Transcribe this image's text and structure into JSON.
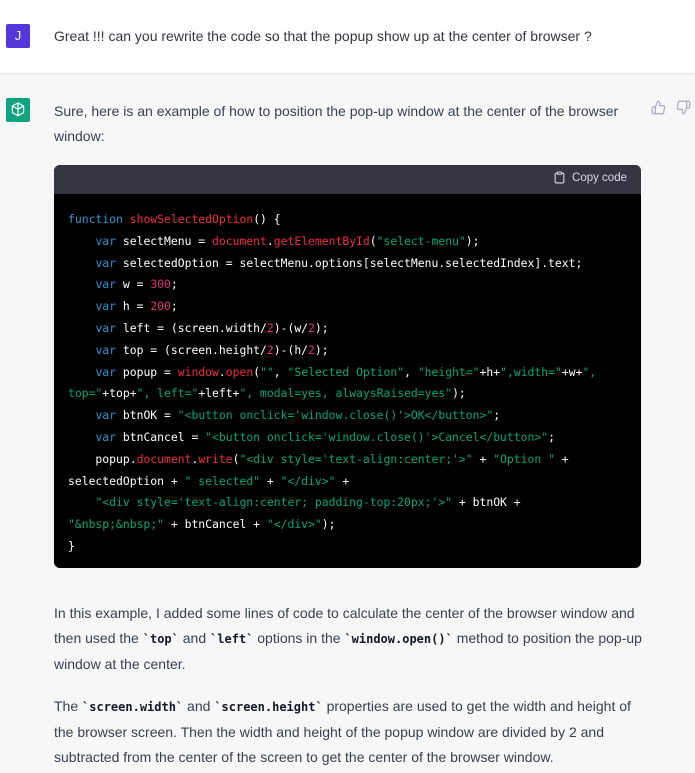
{
  "user": {
    "avatar_letter": "J",
    "message": "Great !!! can you rewrite the code so that the popup show up at the center of browser ?"
  },
  "assistant": {
    "intro": "Sure, here is an example of how to position the pop-up window at the center of the browser window:",
    "copy_label": "Copy code",
    "code_lines": [
      [
        [
          "kw",
          "function "
        ],
        [
          "fn",
          "showSelectedOption"
        ],
        [
          "plain",
          "() {"
        ]
      ],
      [
        [
          "plain",
          "    "
        ],
        [
          "kw",
          "var"
        ],
        [
          "plain",
          " selectMenu = "
        ],
        [
          "fn",
          "document"
        ],
        [
          "plain",
          "."
        ],
        [
          "fn",
          "getElementById"
        ],
        [
          "plain",
          "("
        ],
        [
          "str",
          "\"select-menu\""
        ],
        [
          "plain",
          ");"
        ]
      ],
      [
        [
          "plain",
          "    "
        ],
        [
          "kw",
          "var"
        ],
        [
          "plain",
          " selectedOption = selectMenu.options[selectMenu.selectedIndex].text;"
        ]
      ],
      [
        [
          "plain",
          "    "
        ],
        [
          "kw",
          "var"
        ],
        [
          "plain",
          " w = "
        ],
        [
          "num",
          "300"
        ],
        [
          "plain",
          ";"
        ]
      ],
      [
        [
          "plain",
          "    "
        ],
        [
          "kw",
          "var"
        ],
        [
          "plain",
          " h = "
        ],
        [
          "num",
          "200"
        ],
        [
          "plain",
          ";"
        ]
      ],
      [
        [
          "plain",
          "    "
        ],
        [
          "kw",
          "var"
        ],
        [
          "plain",
          " left = (screen.width/"
        ],
        [
          "num",
          "2"
        ],
        [
          "plain",
          ")-(w/"
        ],
        [
          "num",
          "2"
        ],
        [
          "plain",
          ");"
        ]
      ],
      [
        [
          "plain",
          "    "
        ],
        [
          "kw",
          "var"
        ],
        [
          "plain",
          " top = (screen.height/"
        ],
        [
          "num",
          "2"
        ],
        [
          "plain",
          ")-(h/"
        ],
        [
          "num",
          "2"
        ],
        [
          "plain",
          ");"
        ]
      ],
      [
        [
          "plain",
          "    "
        ],
        [
          "kw",
          "var"
        ],
        [
          "plain",
          " popup = "
        ],
        [
          "fn",
          "window"
        ],
        [
          "plain",
          "."
        ],
        [
          "fn",
          "open"
        ],
        [
          "plain",
          "("
        ],
        [
          "str",
          "\"\""
        ],
        [
          "plain",
          ", "
        ],
        [
          "str",
          "\"Selected Option\""
        ],
        [
          "plain",
          ", "
        ],
        [
          "str",
          "\"height=\""
        ],
        [
          "plain",
          "+h+"
        ],
        [
          "str",
          "\",width=\""
        ],
        [
          "plain",
          "+w+"
        ],
        [
          "str",
          "\","
        ]
      ],
      [
        [
          "str",
          "top=\""
        ],
        [
          "plain",
          "+top+"
        ],
        [
          "str",
          "\", left=\""
        ],
        [
          "plain",
          "+left+"
        ],
        [
          "str",
          "\", modal=yes, alwaysRaised=yes\""
        ],
        [
          "plain",
          ");"
        ]
      ],
      [
        [
          "plain",
          "    "
        ],
        [
          "kw",
          "var"
        ],
        [
          "plain",
          " btnOK = "
        ],
        [
          "str",
          "\"<button onclick='window.close()'>OK</button>\""
        ],
        [
          "plain",
          ";"
        ]
      ],
      [
        [
          "plain",
          "    "
        ],
        [
          "kw",
          "var"
        ],
        [
          "plain",
          " btnCancel = "
        ],
        [
          "str",
          "\"<button onclick='window.close()'>Cancel</button>\""
        ],
        [
          "plain",
          ";"
        ]
      ],
      [
        [
          "plain",
          "    popup."
        ],
        [
          "fn",
          "document"
        ],
        [
          "plain",
          "."
        ],
        [
          "fn",
          "write"
        ],
        [
          "plain",
          "("
        ],
        [
          "str",
          "\"<div style='text-align:center;'>\""
        ],
        [
          "plain",
          " + "
        ],
        [
          "str",
          "\"Option \""
        ],
        [
          "plain",
          " +"
        ]
      ],
      [
        [
          "plain",
          "selectedOption + "
        ],
        [
          "str",
          "\" selected\""
        ],
        [
          "plain",
          " + "
        ],
        [
          "str",
          "\"</div>\""
        ],
        [
          "plain",
          " +"
        ]
      ],
      [
        [
          "plain",
          "    "
        ],
        [
          "str",
          "\"<div style='text-align:center; padding-top:20px;'>\""
        ],
        [
          "plain",
          " + btnOK +"
        ]
      ],
      [
        [
          "str",
          "\"&nbsp;&nbsp;\""
        ],
        [
          "plain",
          " + btnCancel + "
        ],
        [
          "str",
          "\"</div>\""
        ],
        [
          "plain",
          ");"
        ]
      ],
      [
        [
          "plain",
          "}"
        ]
      ]
    ],
    "para1": [
      [
        "text",
        "In this example, I added some lines of code to calculate the center of the browser window and then used the "
      ],
      [
        "code",
        "`top`"
      ],
      [
        "text",
        " and "
      ],
      [
        "code",
        "`left`"
      ],
      [
        "text",
        " options in the "
      ],
      [
        "code",
        "`window.open()`"
      ],
      [
        "text",
        " method to position the pop-up window at the center."
      ]
    ],
    "para2": [
      [
        "text",
        "The "
      ],
      [
        "code",
        "`screen.width`"
      ],
      [
        "text",
        " and "
      ],
      [
        "code",
        "`screen.height`"
      ],
      [
        "text",
        " properties are used to get the width and height of the browser screen. Then the width and height of the popup window are divided by 2 and subtracted from the center of the screen to get the center of the browser window."
      ]
    ]
  },
  "colors": {
    "user_avatar": "#5436da",
    "gpt_avatar": "#10a37f",
    "code_bg": "#000000",
    "code_header": "#343541",
    "keyword": "#2e95d3",
    "function": "#f22c3d",
    "string": "#00a67d",
    "number": "#df3079"
  },
  "icons": {
    "gpt": "openai-logo-icon",
    "copy": "clipboard-icon",
    "like": "thumbs-up-icon",
    "dislike": "thumbs-down-icon"
  }
}
